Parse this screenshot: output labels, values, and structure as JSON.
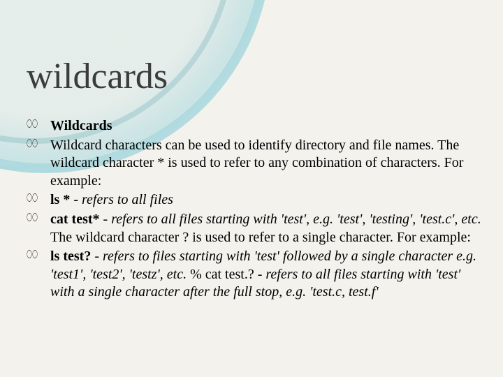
{
  "title": "wildcards",
  "bullets": [
    {
      "bold": "Wildcards"
    },
    {
      "text": "Wildcard characters can be used to identify directory and file names. The wildcard character * is used to refer to any combination of characters. For example:"
    },
    {
      "bold": "ls *",
      "sep": " - ",
      "italic": "refers to all files"
    },
    {
      "bold": "cat test*",
      "sep": " - ",
      "italic1": "refers to all files starting with 'test', e.g. 'test', 'testing', 'test.c', etc. ",
      "text": "The wildcard character ? is used to refer to a single character. For example:"
    },
    {
      "bold": "ls test?",
      "sep": " - ",
      "italic1": "refers to files starting with 'test' followed by a single character e.g. 'test1', 'test2', 'testz', etc. ",
      "text1": "% cat test.? - ",
      "italic2": "refers to all files starting with 'test' with a single character after the full stop, e.g. 'test.c, test.f'"
    }
  ]
}
